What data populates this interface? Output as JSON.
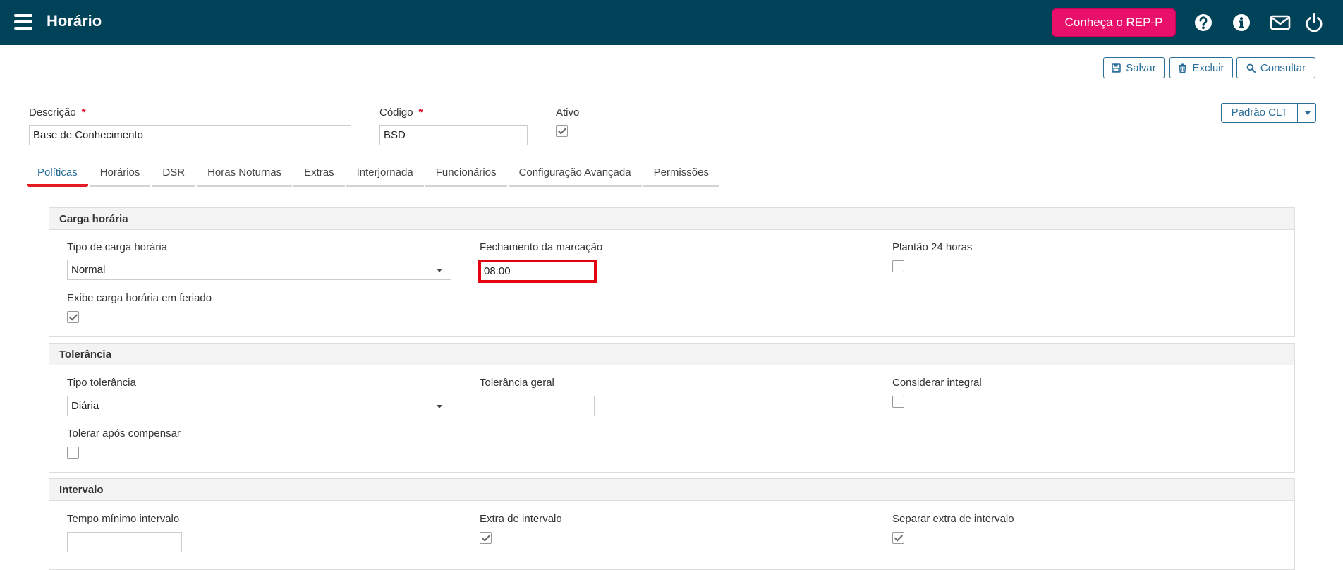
{
  "header": {
    "title": "Horário",
    "cta_label": "Conheça o REP-P",
    "icons": [
      "help-icon",
      "info-icon",
      "mail-icon",
      "power-icon"
    ]
  },
  "toolbar": {
    "save_label": "Salvar",
    "delete_label": "Excluir",
    "search_label": "Consultar"
  },
  "form": {
    "descricao_label": "Descrição",
    "descricao_value": "Base de Conhecimento",
    "codigo_label": "Código",
    "codigo_value": "BSD",
    "required_mark": "*",
    "ativo_label": "Ativo",
    "ativo_checked": true,
    "template_select": "Padrão CLT"
  },
  "tabs": [
    {
      "label": "Políticas",
      "active": true
    },
    {
      "label": "Horários"
    },
    {
      "label": "DSR"
    },
    {
      "label": "Horas Noturnas"
    },
    {
      "label": "Extras"
    },
    {
      "label": "Interjornada"
    },
    {
      "label": "Funcionários"
    },
    {
      "label": "Configuração Avançada"
    },
    {
      "label": "Permissões"
    }
  ],
  "carga": {
    "title": "Carga horária",
    "tipo_label": "Tipo de carga horária",
    "tipo_value": "Normal",
    "fechamento_label": "Fechamento da marcação",
    "fechamento_value": "08:00",
    "plantao_label": "Plantão 24 horas",
    "exibe_label": "Exibe carga horária em feriado"
  },
  "tolerancia": {
    "title": "Tolerância",
    "tipo_label": "Tipo tolerância",
    "tipo_value": "Diária",
    "geral_label": "Tolerância geral",
    "geral_value": "",
    "integral_label": "Considerar integral",
    "compensar_label": "Tolerar após compensar"
  },
  "intervalo": {
    "title": "Intervalo",
    "tempo_label": "Tempo mínimo intervalo",
    "tempo_value": "",
    "extra_label": "Extra de intervalo",
    "separar_label": "Separar extra de intervalo"
  },
  "colors": {
    "header_bg": "#004358",
    "cta_bg": "#e8106a",
    "accent": "#2a6e9a",
    "active_tab_underline": "#e31b23",
    "highlight_border": "#e3000f"
  }
}
